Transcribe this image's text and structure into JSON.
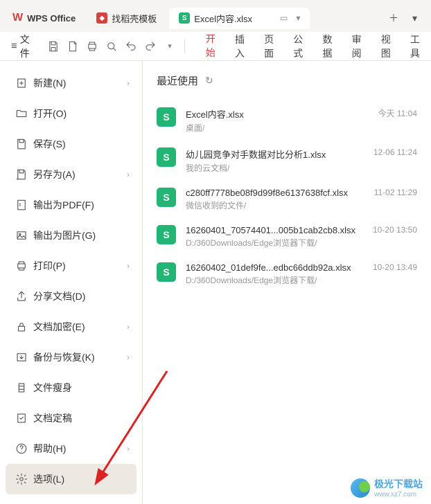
{
  "titlebar": {
    "app_name": "WPS Office",
    "tab_template": "找稻壳模板",
    "tab_doc": "Excel内容.xlsx"
  },
  "toolbar": {
    "file_label": "文件"
  },
  "ribbon": {
    "start": "开始",
    "insert": "插入",
    "page": "页面",
    "formula": "公式",
    "data": "数据",
    "review": "审阅",
    "view": "视图",
    "tools": "工具"
  },
  "file_menu": {
    "new": "新建(N)",
    "open": "打开(O)",
    "save": "保存(S)",
    "saveas": "另存为(A)",
    "export_pdf": "输出为PDF(F)",
    "export_img": "输出为图片(G)",
    "print": "打印(P)",
    "share": "分享文档(D)",
    "encrypt": "文档加密(E)",
    "backup": "备份与恢复(K)",
    "slim": "文件瘦身",
    "finalize": "文档定稿",
    "help": "帮助(H)",
    "options": "选项(L)"
  },
  "recent": {
    "heading": "最近使用",
    "files": [
      {
        "name": "Excel内容.xlsx",
        "path": "桌面/",
        "time": "今天  11:04"
      },
      {
        "name": "幼儿园竞争对手数据对比分析1.xlsx",
        "path": "我的云文档/",
        "time": "12-06  11:24"
      },
      {
        "name": "c280ff7778be08f9d99f8e6137638fcf.xlsx",
        "path": "微信收到的文件/",
        "time": "11-02  11:29"
      },
      {
        "name": "16260401_70574401...005b1cab2cb8.xlsx",
        "path": "D:/360Downloads/Edge浏览器下载/",
        "time": "10-20  13:50"
      },
      {
        "name": "16260402_01def9fe...edbc66ddb92a.xlsx",
        "path": "D:/360Downloads/Edge浏览器下载/",
        "time": "10-20  13:49"
      }
    ]
  },
  "watermark": {
    "text": "极光下载站",
    "sub": "www.xz7.com"
  }
}
